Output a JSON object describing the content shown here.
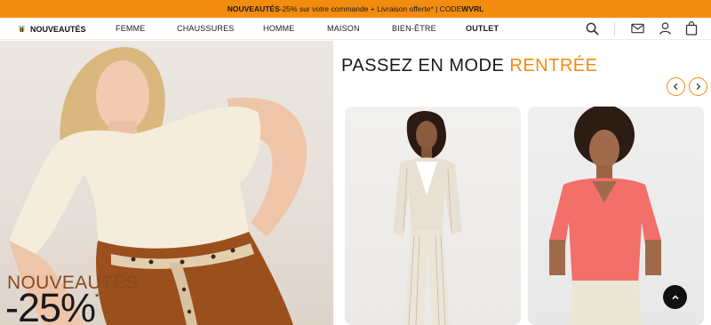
{
  "promo": {
    "highlight": "NOUVEAUTÉS",
    "text": " -25% sur votre commande + Livraison offerte* | CODE ",
    "code": "WVRL"
  },
  "nav": {
    "brand": "NOUVEAUTÉS",
    "items": [
      "FEMME",
      "CHAUSSURES",
      "HOMME",
      "MAISON",
      "BIEN-ÊTRE",
      "OUTLET"
    ],
    "icons": [
      "search-icon",
      "mail-icon",
      "account-icon",
      "bag-icon"
    ]
  },
  "hero": {
    "caption_line1": "NOUVEAUTÉS",
    "caption_line2": "-25%",
    "asterisk": "*"
  },
  "section": {
    "title": "PASSEZ EN MODE ",
    "title_accent": "RENTRÉE"
  },
  "colors": {
    "accent": "#f28c0f",
    "caption_brown": "#8a4a1e"
  }
}
